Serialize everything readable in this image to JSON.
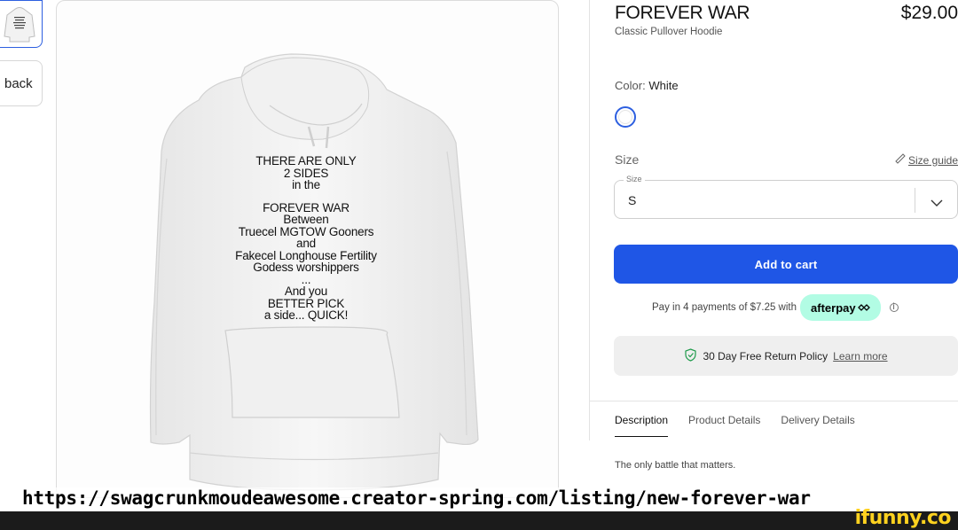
{
  "thumbnail": {
    "alt_icon": "hoodie-thumbnail-icon"
  },
  "back_button": {
    "label": "back"
  },
  "product": {
    "title": "FOREVER WAR",
    "price": "$29.00",
    "subtitle": "Classic Pullover Hoodie",
    "color_label": "Color:",
    "color_value": "White",
    "size_label": "Size",
    "size_guide": "Size guide",
    "size_select": {
      "float_label": "Size",
      "value": "S"
    },
    "add_to_cart": "Add to cart",
    "payment_text": "Pay in 4 payments of $7.25 with",
    "afterpay_brand": "afterpay",
    "returns_text": "30 Day Free Return Policy",
    "returns_link": "Learn more"
  },
  "hoodie_print": [
    "THERE ARE ONLY",
    "2 SIDES",
    "in the",
    "",
    "FOREVER WAR",
    "Between",
    "Truecel MGTOW Gooners",
    "and",
    "Fakecel Longhouse Fertility",
    "Godess worshippers",
    "...",
    "And you",
    "BETTER PICK",
    "a side... QUICK!"
  ],
  "tabs": [
    {
      "label": "Description",
      "active": true
    },
    {
      "label": "Product Details",
      "active": false
    },
    {
      "label": "Delivery Details",
      "active": false
    }
  ],
  "description_text": "The only battle that matters.",
  "url_caption": "https://swagcrunkmoudeawesome.creator-spring.com/listing/new-forever-war",
  "watermark": "ifunny.co",
  "colors": {
    "accent": "#1f56e6",
    "afterpay": "#b2fce4",
    "watermark": "#ffd21f"
  }
}
